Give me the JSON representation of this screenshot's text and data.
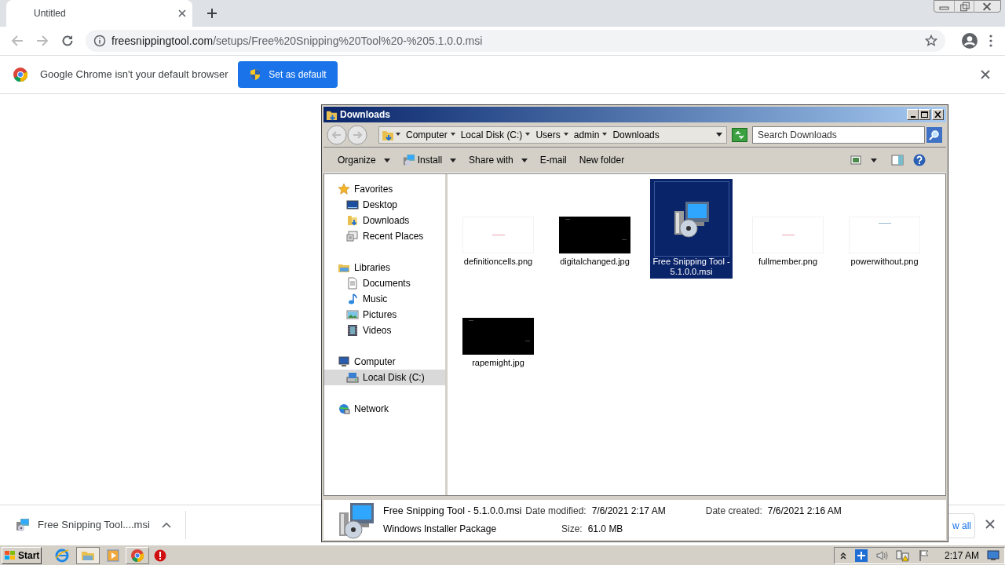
{
  "browser": {
    "tab": {
      "title": "Untitled"
    },
    "url": {
      "host": "freesnippingtool.com",
      "path": "/setups/Free%20Snipping%20Tool%20-%205.1.0.0.msi"
    },
    "infobar": {
      "message": "Google Chrome isn't your default browser",
      "button": "Set as default"
    },
    "download_bar": {
      "file": "Free Snipping Tool....msi",
      "show_all": "w all"
    }
  },
  "explorer": {
    "title": "Downloads",
    "breadcrumb": [
      "Computer",
      "Local Disk (C:)",
      "Users",
      "admin",
      "Downloads"
    ],
    "search": {
      "placeholder": "Search Downloads"
    },
    "toolbar": [
      {
        "label": "Organize",
        "kind": "menu"
      },
      {
        "label": "Install",
        "kind": "install"
      },
      {
        "label": "Share with",
        "kind": "menu"
      },
      {
        "label": "E-mail",
        "kind": "plain"
      },
      {
        "label": "New folder",
        "kind": "plain"
      }
    ],
    "nav": [
      {
        "label": "Favorites",
        "kind": "star",
        "selected": false,
        "children": [
          {
            "label": "Desktop",
            "kind": "desktop",
            "selected": false
          },
          {
            "label": "Downloads",
            "kind": "folder",
            "selected": false
          },
          {
            "label": "Recent Places",
            "kind": "places",
            "selected": false
          }
        ]
      },
      {
        "label": "Libraries",
        "kind": "library",
        "selected": false,
        "children": [
          {
            "label": "Documents",
            "kind": "document",
            "selected": false
          },
          {
            "label": "Music",
            "kind": "music",
            "selected": false
          },
          {
            "label": "Pictures",
            "kind": "pictures",
            "selected": false
          },
          {
            "label": "Videos",
            "kind": "videos",
            "selected": false
          }
        ]
      },
      {
        "label": "Computer",
        "kind": "computer",
        "selected": false,
        "children": [
          {
            "label": "Local Disk (C:)",
            "kind": "disk",
            "selected": true
          }
        ]
      },
      {
        "label": "Network",
        "kind": "network",
        "selected": false
      }
    ],
    "files": [
      {
        "name": "definitioncells.png",
        "kind": "light",
        "selected": false
      },
      {
        "name": "digitalchanged.jpg",
        "kind": "dark",
        "selected": false
      },
      {
        "name": "Free Snipping Tool - 5.1.0.0.msi",
        "kind": "installer",
        "selected": true
      },
      {
        "name": "fullmember.png",
        "kind": "light",
        "selected": false
      },
      {
        "name": "powerwithout.png",
        "kind": "light",
        "selected": false
      },
      {
        "name": "rapemight.jpg",
        "kind": "dark",
        "selected": false
      }
    ],
    "details": {
      "name": "Free Snipping Tool - 5.1.0.0.msi",
      "type": "Windows Installer Package",
      "modified_label": "Date modified:",
      "modified": "7/6/2021 2:17 AM",
      "size_label": "Size:",
      "size": "61.0 MB",
      "created_label": "Date created:",
      "created": "7/6/2021 2:16 AM"
    }
  },
  "taskbar": {
    "start": "Start",
    "clock": "2:17 AM"
  }
}
